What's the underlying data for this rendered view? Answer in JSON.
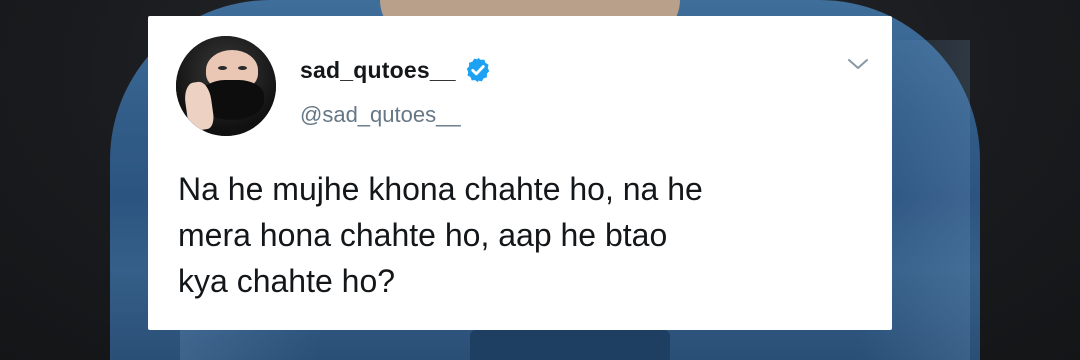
{
  "tweet": {
    "display_name": "sad_qutoes__",
    "handle": "@sad_qutoes__",
    "verified": true,
    "text_lines": [
      "Na he mujhe khona chahte ho, na he",
      "mera hona chahte ho, aap he btao",
      "kya chahte ho?"
    ]
  },
  "icons": {
    "verified": "verified-badge-icon",
    "menu": "chevron-down-icon"
  },
  "colors": {
    "card_background": "#ffffff",
    "verified_blue": "#1da1f2",
    "handle_gray": "#657786",
    "text_dark": "#14171a"
  }
}
